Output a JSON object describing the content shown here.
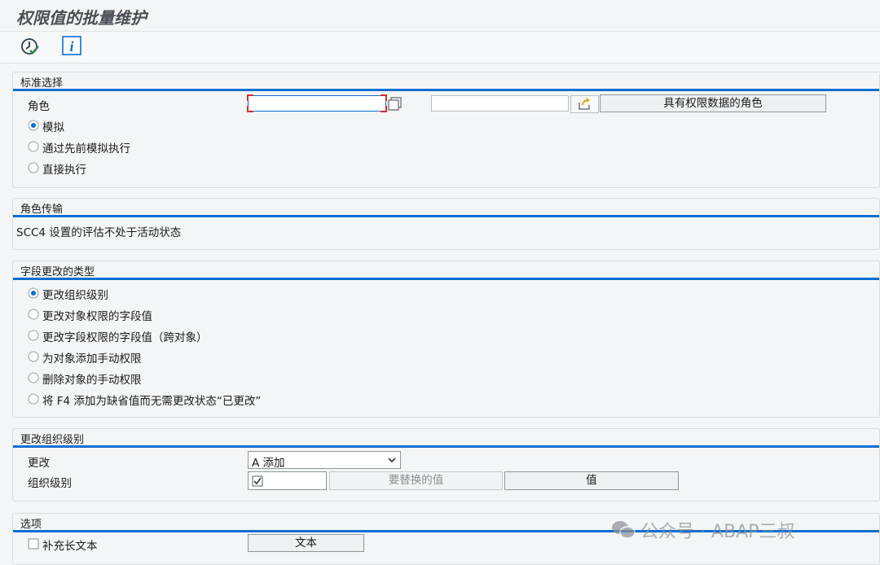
{
  "window": {
    "title": "权限值的批量维护"
  },
  "toolbar": {
    "execute_icon": "execute-check-icon",
    "info_icon": "info-icon",
    "info_glyph": "i"
  },
  "section_standard": {
    "title": "标准选择",
    "role_label": "角色",
    "role_value_from": "",
    "role_value_to": "",
    "role_button": "具有权限数据的角色",
    "radios": [
      "模拟",
      "通过先前模拟执行",
      "直接执行"
    ],
    "selected": 0
  },
  "section_transport": {
    "title": "角色传输",
    "message": "SCC4 设置的评估不处于活动状态"
  },
  "section_type": {
    "title": "字段更改的类型",
    "radios": [
      "更改组织级别",
      "更改对象权限的字段值",
      "更改字段权限的字段值（跨对象）",
      "为对象添加手动权限",
      "删除对象的手动权限",
      "将 F4 添加为缺省值而无需更改状态“已更改”"
    ],
    "selected": 0
  },
  "section_org": {
    "title": "更改组织级别",
    "change_label": "更改",
    "change_value": "A 添加",
    "org_label": "组织级别",
    "replace_button": "要替换的值",
    "value_button": "值"
  },
  "section_options": {
    "title": "选项",
    "longtext_label": "补充长文本",
    "text_button": "文本"
  },
  "watermark": "公众号 · ABAP三叔",
  "colors": {
    "accent": "#0a6ed1",
    "background": "#f4f5f6",
    "title": "#4a4f55"
  }
}
